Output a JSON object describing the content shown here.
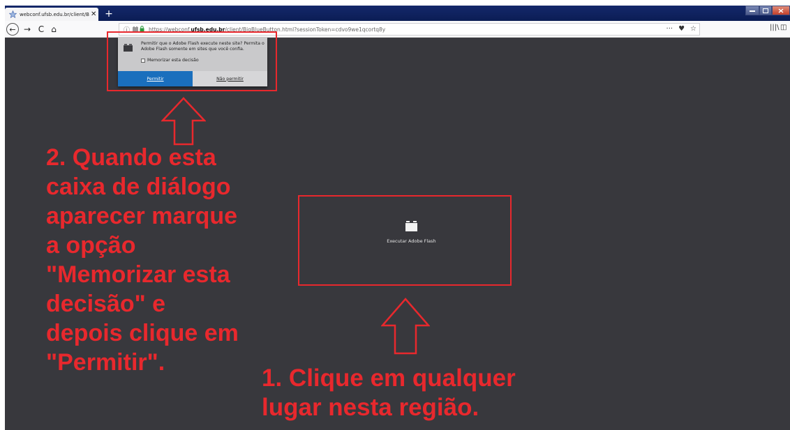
{
  "browser": {
    "tab": {
      "title": "webconf.ufsb.edu.br/client/Bi",
      "close_glyph": "✕",
      "favicon": "globe-icon"
    },
    "new_tab_glyph": "+",
    "nav": {
      "back_glyph": "←",
      "forward_glyph": "→",
      "reload_glyph": "C",
      "home_glyph": "⌂"
    },
    "url": {
      "prefix": "https://webconf.",
      "domain": "ufsb.edu.br",
      "path": "/client/BigBlueButton.html?sessionToken=cdvo9we1qcortq8y"
    },
    "page_actions": {
      "more_glyph": "···",
      "pocket_glyph": "♥",
      "bookmark_glyph": "☆"
    },
    "toolbar": {
      "library_glyph": "|||\\",
      "sidebar_glyph": "◫",
      "menu_glyph": "≡"
    }
  },
  "flash_popup": {
    "message": "Permitir que o Adobe Flash execute neste site? Permita o Adobe Flash somente em sites que você confia.",
    "remember_label": "Memorizar esta decisão",
    "allow_label": "Permitir",
    "deny_label": "Não permitir"
  },
  "flash_placeholder": {
    "label": "Executar Adobe Flash"
  },
  "annotations": {
    "step2_lines": [
      "2. Quando esta",
      "caixa de diálogo",
      "aparecer marque",
      "a opção",
      "\"Memorizar esta",
      "decisão\" e",
      "depois clique em",
      "\"Permitir\"."
    ],
    "step1_lines": [
      "1. Clique em qualquer",
      "lugar nesta região."
    ]
  },
  "colors": {
    "annotation": "#e8282d",
    "content_bg": "#38383d",
    "allow_button": "#1a6fbd",
    "titlebar": "#14286a"
  }
}
